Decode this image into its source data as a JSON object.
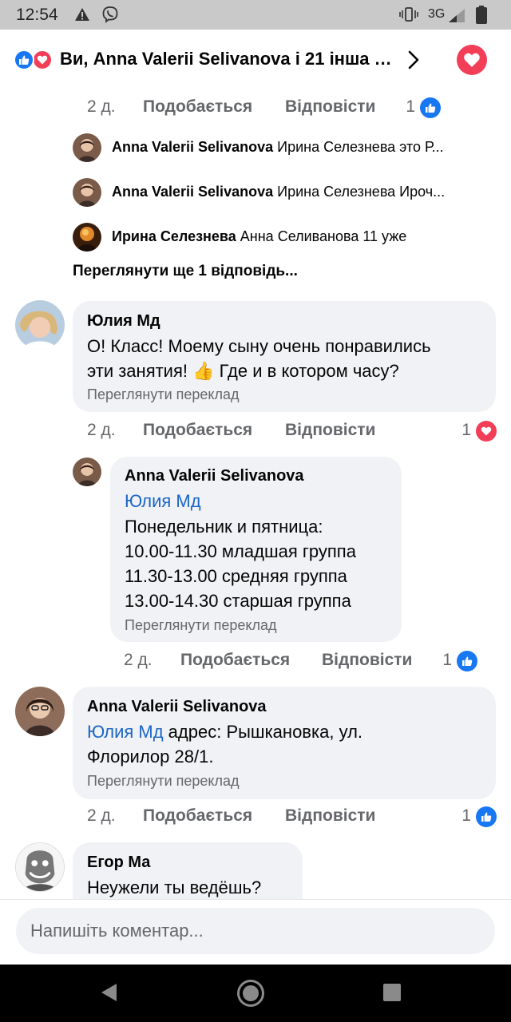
{
  "status_bar": {
    "time": "12:54",
    "network": "3G",
    "icons": [
      "warning-icon",
      "viber-icon",
      "vibrate-icon",
      "signal-icon",
      "battery-icon"
    ]
  },
  "reactions_header": {
    "text": "Ви, Anna Valerii Selivanova і 21 інша о...",
    "icons": [
      "like-icon",
      "love-icon",
      "chevron-right-icon",
      "love-reaction-button"
    ]
  },
  "labels": {
    "like": "Подобається",
    "reply": "Відповісти",
    "translate": "Переглянути переклад"
  },
  "top_action_row": {
    "time": "2 д.",
    "count": "1",
    "reaction": "like"
  },
  "collapsed_replies": [
    {
      "author": "Anna Valerii Selivanova",
      "text": "Ирина Селезнева это Р..."
    },
    {
      "author": "Anna Valerii Selivanova",
      "text": "Ирина Селезнева Ироч..."
    },
    {
      "author": "Ирина Селезнева",
      "text": "Анна Селиванова 11 уже"
    }
  ],
  "more_replies": "Переглянути ще 1 відповідь...",
  "comments": [
    {
      "author": "Юлия Мд",
      "lines": [
        "О! Класс! Моему сыну очень понравились",
        "эти занятия! 👍 Где и в котором часу?"
      ],
      "time": "2 д.",
      "count": "1",
      "reaction": "love"
    },
    {
      "author": "Anna Valerii Selivanova",
      "mention": "Юлия Мд",
      "lines": [
        "Понедельник и пятница:",
        "10.00-11.30 младшая группа",
        "11.30-13.00 средняя группа",
        "13.00-14.30 старшая группа"
      ],
      "time": "2 д.",
      "count": "1",
      "reaction": "like"
    },
    {
      "author": "Anna Valerii Selivanova",
      "mention": "Юлия Мд",
      "lines": [
        " адрес: Рышкановка, ул.",
        "Флорилор  28/1."
      ],
      "time": "2 д.",
      "count": "1",
      "reaction": "like"
    },
    {
      "author": "Егор Ма",
      "lines": [
        "Неужели ты ведёшь?"
      ]
    }
  ],
  "composer": {
    "placeholder": "Напишіть коментар..."
  },
  "nav_bar": {
    "icons": [
      "back-icon",
      "home-icon",
      "recents-icon"
    ]
  }
}
